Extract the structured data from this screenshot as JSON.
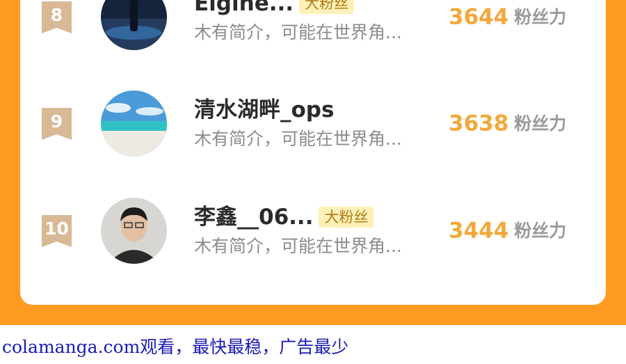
{
  "leaderboard": {
    "rows": [
      {
        "rank": "8",
        "name": "Elgine...",
        "tag": "大粉丝",
        "intro": "木有简介，可能在世界角...",
        "score": "3644",
        "unit": "粉丝力"
      },
      {
        "rank": "9",
        "name": "清水湖畔_ops",
        "tag": "",
        "intro": "木有简介，可能在世界角...",
        "score": "3638",
        "unit": "粉丝力"
      },
      {
        "rank": "10",
        "name": "李鑫__06...",
        "tag": "大粉丝",
        "intro": "木有简介，可能在世界角...",
        "score": "3444",
        "unit": "粉丝力"
      }
    ]
  },
  "footer": {
    "text": "colamanga.com观看，最快最稳，广告最少"
  },
  "colors": {
    "background": "#ff9b21",
    "score": "#f2a83a",
    "tag_bg": "#fff0b8",
    "footer_text": "#1a1ab8"
  }
}
